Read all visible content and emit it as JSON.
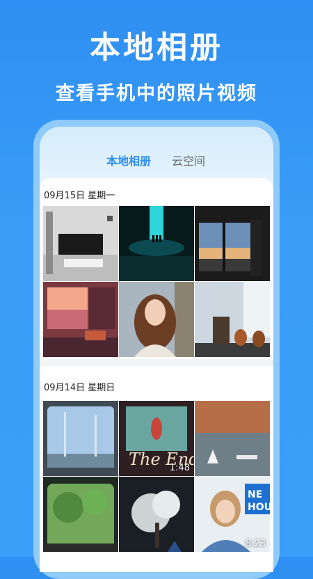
{
  "promo": {
    "title": "本地相册",
    "subtitle": "查看手机中的照片视频"
  },
  "tabs": [
    {
      "label": "本地相册",
      "active": true
    },
    {
      "label": "云空间",
      "active": false
    }
  ],
  "groups": [
    {
      "date": "09月15日  星期一",
      "items": [
        {
          "type": "photo",
          "subject": "living room with tv"
        },
        {
          "type": "photo",
          "subject": "glowing portal in water"
        },
        {
          "type": "photo",
          "subject": "window with sunset"
        },
        {
          "type": "photo",
          "subject": "illustrated room at dusk"
        },
        {
          "type": "photo",
          "subject": "woman portrait in street"
        },
        {
          "type": "photo",
          "subject": "room with guitars"
        }
      ]
    },
    {
      "date": "09月14日  星期日",
      "items": [
        {
          "type": "photo",
          "subject": "train window view"
        },
        {
          "type": "video",
          "subject": "the end film frame",
          "duration": "1:48"
        },
        {
          "type": "photo",
          "subject": "harbour town aerial"
        },
        {
          "type": "photo",
          "subject": "trees through window"
        },
        {
          "type": "photo",
          "subject": "blossom tree at night"
        },
        {
          "type": "video",
          "subject": "smiling woman vlog",
          "duration": "8:23"
        }
      ]
    }
  ],
  "colors": {
    "accent": "#2f8ff2",
    "background": "#3b9ef8"
  }
}
